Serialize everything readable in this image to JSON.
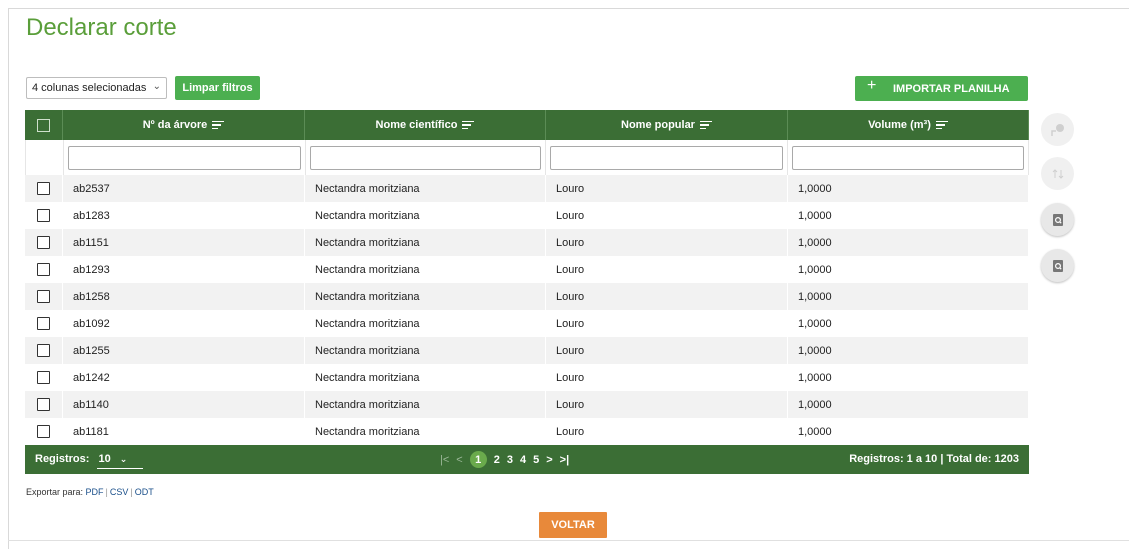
{
  "page": {
    "title": "Declarar corte"
  },
  "toolbar": {
    "column_select": "4 colunas selecionadas",
    "clear_filters": "Limpar filtros",
    "import_plus": "+",
    "import_label": "IMPORTAR PLANILHA"
  },
  "table": {
    "columns": [
      "Nº da árvore",
      "Nome científico",
      "Nome popular",
      "Volume (m³)"
    ],
    "rows": [
      [
        "ab2537",
        "Nectandra moritziana",
        "Louro",
        "1,0000"
      ],
      [
        "ab1283",
        "Nectandra moritziana",
        "Louro",
        "1,0000"
      ],
      [
        "ab1151",
        "Nectandra moritziana",
        "Louro",
        "1,0000"
      ],
      [
        "ab1293",
        "Nectandra moritziana",
        "Louro",
        "1,0000"
      ],
      [
        "ab1258",
        "Nectandra moritziana",
        "Louro",
        "1,0000"
      ],
      [
        "ab1092",
        "Nectandra moritziana",
        "Louro",
        "1,0000"
      ],
      [
        "ab1255",
        "Nectandra moritziana",
        "Louro",
        "1,0000"
      ],
      [
        "ab1242",
        "Nectandra moritziana",
        "Louro",
        "1,0000"
      ],
      [
        "ab1140",
        "Nectandra moritziana",
        "Louro",
        "1,0000"
      ],
      [
        "ab1181",
        "Nectandra moritziana",
        "Louro",
        "1,0000"
      ]
    ]
  },
  "footer": {
    "registros_label": "Registros:",
    "page_size": "10",
    "pages": [
      "1",
      "2",
      "3",
      "4",
      "5"
    ],
    "current_page": "1",
    "first": "|<",
    "prev": "<",
    "next": ">",
    "last": ">|",
    "total": "Registros: 1 a 10 | Total de: 1203"
  },
  "export": {
    "label": "Exportar para:",
    "pdf": "PDF",
    "csv": "CSV",
    "odt": "ODT",
    "sep": "|"
  },
  "actions": {
    "voltar": "VOLTAR"
  },
  "icons": {
    "side": [
      "map-pin-person-icon",
      "sort-arrows-icon",
      "document-search-icon",
      "document-search-icon"
    ]
  },
  "colors": {
    "header_green": "#3b6e35",
    "button_green": "#4caf50",
    "title_green": "#5a9e3a",
    "voltar_orange": "#e8893a"
  }
}
